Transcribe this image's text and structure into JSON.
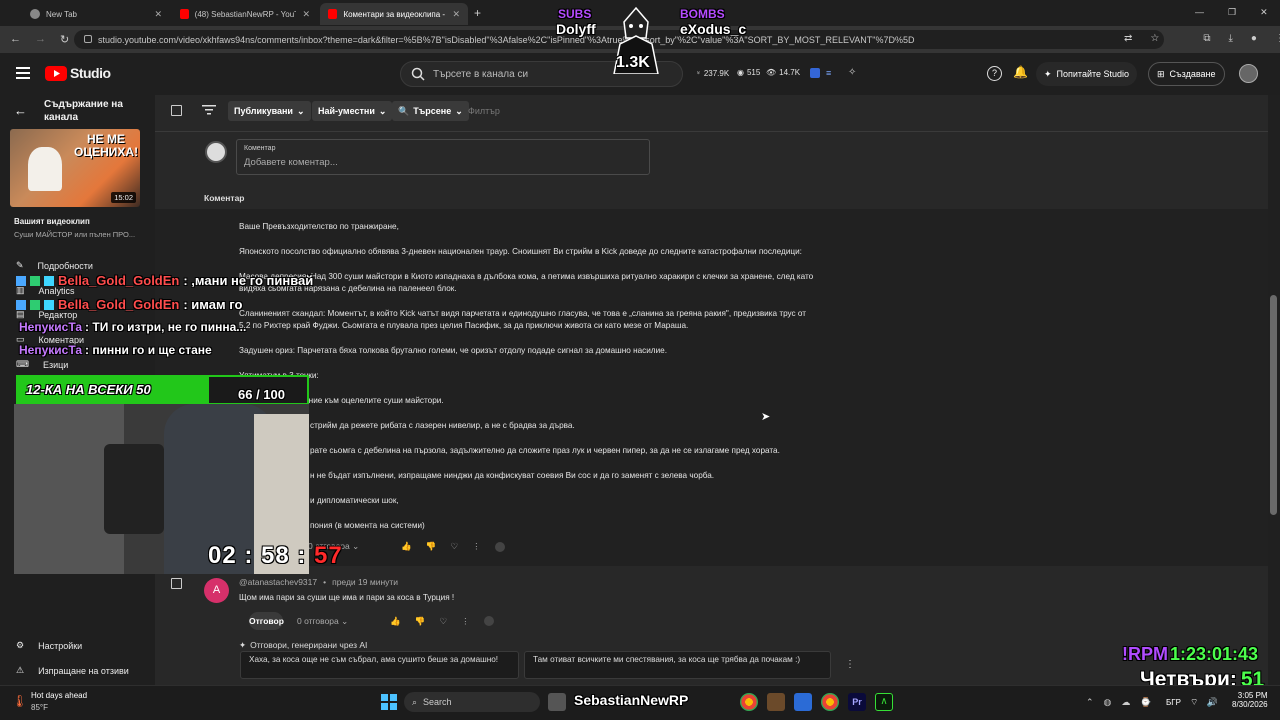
{
  "browser": {
    "tabs": [
      {
        "label": "New Tab"
      },
      {
        "label": "(48) SebastianNewRP - YouTube"
      },
      {
        "label": "Коментари за видеоклипа - Y"
      }
    ],
    "url": "studio.youtube.com/video/xkhfaws94ns/comments/inbox?theme=dark&filter=%5B%7B\"isDisabled\"%3Afalse%2C\"isPinned\"%3Atrue%2C\"sort_by\"%2C\"value\"%3A\"SORT_BY_MOST_RELEVANT\"%7D%5D"
  },
  "header": {
    "logo": "Studio",
    "search_placeholder": "Търсете в канала си",
    "stats": {
      "subs": "237.9K",
      "views": "515",
      "likes": "14.7K"
    },
    "ask_studio": "Попитайте Studio",
    "create": "Създаване"
  },
  "sidebar": {
    "back_title": "Съдържание на канала",
    "video_thumb_text": "НЕ МЕ ОЦЕНИХА!",
    "duration": "15:02",
    "your_video": "Вашият видеоклип",
    "video_title": "Суши МАЙСТОР или пълен ПРО...",
    "items": [
      {
        "label": "Подробности"
      },
      {
        "label": "Analytics"
      },
      {
        "label": "Редактор"
      },
      {
        "label": "Коментари"
      },
      {
        "label": "Езици"
      }
    ],
    "settings": "Настройки",
    "feedback": "Изпращане на отзиви"
  },
  "filters": {
    "published": "Публикувани",
    "most_relevant": "Най-уместни",
    "search": "Търсене",
    "filter_placeholder": "Филтър"
  },
  "comment_box": {
    "label": "Коментар",
    "placeholder": "Добавете коментар..."
  },
  "section_label": "Коментар",
  "first_comment": {
    "lines": [
      "Ваше Превъзходителство по транжиране,",
      "Японското посолство официално обявява 3-дневен национален траур. Сноишнят Ви стрийм в Kick доведе до следните катастрофални последици:",
      "Масова депресия: Над 300 суши майстори в Киото изпаднаха в дълбока кома, а петима извършиха ритуално харакири с клечки за хранене, след като",
      "видяха сьомгата нарязана с дебелина на паленеел блок.",
      "Сланиненият скандал: Моментът, в който Kick чатът видя парчетата и единодушно гласува, че това е „сланина за греяна ракия\", предизвика трус от",
      "5.2 по Рихтер край Фуджи. Сьомгата е плувала през целия Пасифик, за да приключи живота си като мезе от Мараша.",
      "Задушен ориз: Парчетата бяха толкова брутално големи, че оризът отдолу подаде сигнал за домашно насилие.",
      "Ултиматум в 3 точки:",
      "Незабавно извинение към оцелелите суши майстори.",
      "стрийм да режете рибата с лазерен нивелир, а не с брадва за дърва.",
      "рате сьомга с дебелина на пързола, задължително да сложите праз лук и червен пипер, за да не се излагаме пред хората.",
      "н не бъдат изпълнени, изпращаме нинджи да конфискуват соевия Ви сос и да го заменят с зелева чорба.",
      "и дипломатически шок,",
      "пония (в момента на системи)"
    ],
    "replies": "0 отговора"
  },
  "second_comment": {
    "author": "@atanastachev9317",
    "time": "преди 19 минути",
    "avatar_letter": "A",
    "text": "Щом има пари за суши ще има и пари за коса в Турция !",
    "reply_button": "Отговор",
    "replies": "0 отговора"
  },
  "ai_replies": {
    "label": "Отговори, генерирани чрез AI",
    "suggestions": [
      "Хаха, за коса още не съм събрал, ама сушито беше за домашно!",
      "Там отиват всичките ми спестявания, за коса ще трябва да почакам :)"
    ]
  },
  "overlay": {
    "subs_label": "SUBS",
    "subs_name": "Dolyff",
    "bombs_label": "BOMBS",
    "bombs_name": "eXodus_c",
    "center_count": "1.3K",
    "chat": [
      {
        "user": "Bella_Gold_GoldEn",
        "msg": ": ,мани не го пинвай"
      },
      {
        "user": "Bella_Gold_GoldEn",
        "msg": ": имам го"
      },
      {
        "user": "НепукисТа",
        "msg": ": ТИ го изтри, не го пинна..."
      },
      {
        "user": "НепукисТа",
        "msg": ": пинни го и ще стане"
      }
    ],
    "goal_text": "12-КА НА ВСЕКИ 50",
    "goal_count": "66 / 100",
    "goal_progress": 0.66,
    "timer": "02 : 58 : 57",
    "rpm_label": "!RPM",
    "rpm_time": "1:23:01:43",
    "thursdays_label": "Четвъри:",
    "thursdays_count": "51"
  },
  "taskbar": {
    "weather_title": "Hot days ahead",
    "weather_temp": "85°F",
    "search": "Search",
    "language": "БГР",
    "time": "3:05 PM",
    "date": "8/30/2026",
    "streamer_name": "SebastianNewRP"
  },
  "colors": {
    "accent_green": "#22c71a",
    "chat_name": "#ff4d4d",
    "chat_name2": "#c67aff",
    "timer_red": "#ff2a2a",
    "rpm_purple": "#b04cff",
    "rpm_green": "#4cff4c"
  }
}
